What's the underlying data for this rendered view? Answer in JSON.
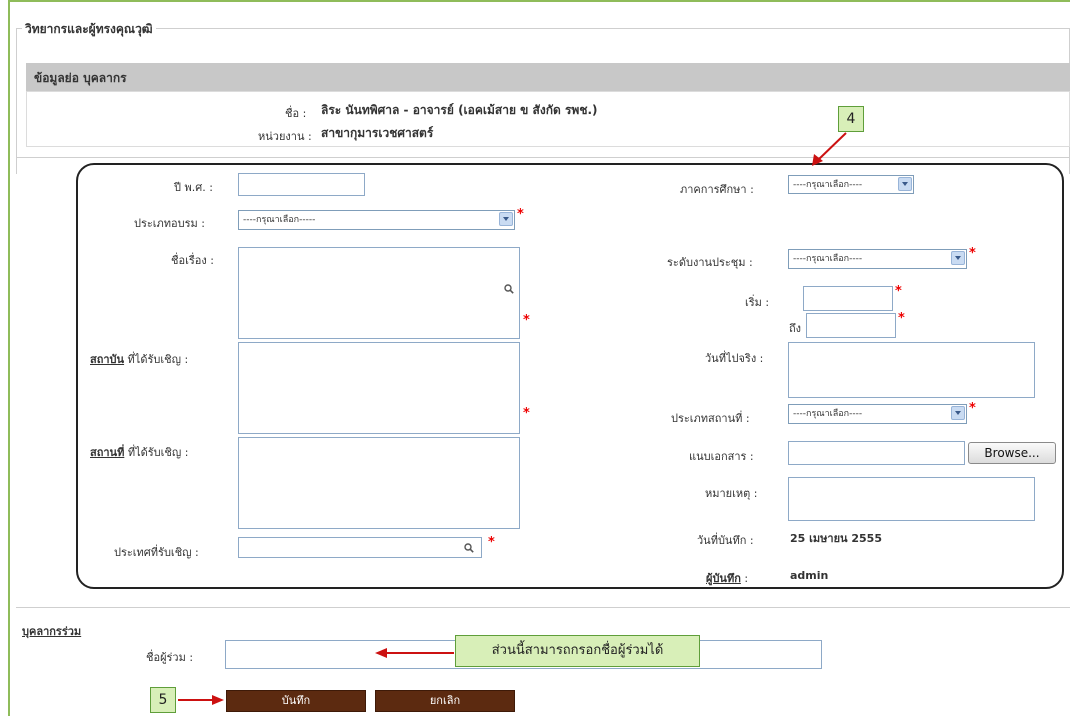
{
  "section": {
    "legend": "วิทยากรและผู้ทรงคุณวุฒิ",
    "header_title": "ข้อมูลย่อ บุคลากร",
    "name_label": "ชื่อ :",
    "name_value": "ลิระ นันทพิศาล -  อาจารย์ (เอคเม้สาย ข สังกัด รพช.)",
    "dept_label": "หน่วยงาน :",
    "dept_value": "สาขากุมารเวชศาสตร์"
  },
  "form": {
    "year_label": "ปี พ.ศ. :",
    "year_value": "",
    "train_type_label": "ประเภทอบรม :",
    "train_type_value": "----กรุณาเลือก-----",
    "topic_label": "ชื่อเรื่อง :",
    "institute_label_ul": "สถาบัน",
    "institute_label_rest": " ที่ได้รับเชิญ :",
    "place_label_ul": "สถานที่",
    "place_label_rest": " ที่ได้รับเชิญ :",
    "country_label": "ประเทศที่รับเชิญ :",
    "semester_label": "ภาคการศึกษา :",
    "semester_value": "----กรุณาเลือก----",
    "meeting_level_label": "ระดับงานประชุม :",
    "meeting_level_value": "----กรุณาเลือก----",
    "start_label": "เริ่ม :",
    "end_label": "ถึง",
    "actual_date_label": "วันที่ไปจริง :",
    "venue_type_label": "ประเภทสถานที่ :",
    "venue_type_value": "----กรุณาเลือก----",
    "attach_label": "แนบเอกสาร :",
    "browse_label": "Browse...",
    "remark_label": "หมายเหตุ :",
    "record_date_label": "วันที่บันทึก :",
    "record_date_value": "25 เมษายน 2555",
    "recorder_label": "ผู้บันทึก",
    "recorder_colon": ":",
    "recorder_value": "admin"
  },
  "co": {
    "section_label": "บุคลากรร่วม",
    "name_label": "ชื่อผู้ร่วม :",
    "name_value": ""
  },
  "buttons": {
    "save": "บันทึก",
    "cancel": "ยกเลิก"
  },
  "annotations": {
    "callout_4": "4",
    "callout_5": "5",
    "callout_note": "ส่วนนี้สามารถกรอกชื่อผู้ร่วมได้"
  },
  "colors": {
    "frame_green": "#8fbc5a",
    "callout_bg": "#d8efb8",
    "button_brown": "#5c2a10",
    "required_red": "#e00000",
    "arrow_red": "#cc1111"
  }
}
